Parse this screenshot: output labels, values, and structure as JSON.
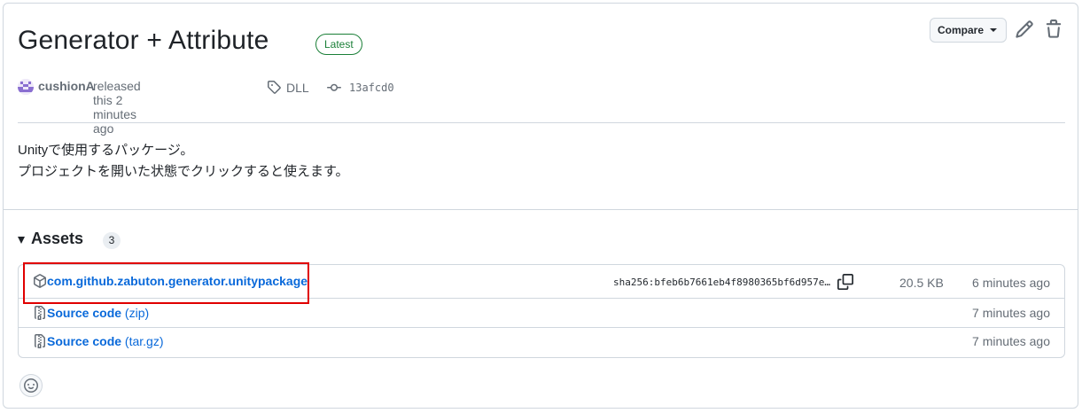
{
  "release": {
    "title": "Generator + Attribute",
    "badge": "Latest",
    "author": "cushionA",
    "released_text": "released this 2 minutes ago",
    "tag": "DLL",
    "commit": "13afcd0"
  },
  "toolbar": {
    "compare_label": "Compare",
    "edit_icon": "pencil-icon",
    "delete_icon": "trash-icon"
  },
  "description": {
    "line1": "Unityで使用するパッケージ。",
    "line2": "プロジェクトを開いた状態でクリックすると使えます。"
  },
  "assets": {
    "title": "Assets",
    "count": "3",
    "items": [
      {
        "name": "com.github.zabuton.generator.unitypackage",
        "sub": "",
        "sha": "sha256:bfeb6b7661eb4f8980365bf6d957e…",
        "size": "20.5 KB",
        "time": "6 minutes ago",
        "icon": "package-icon"
      },
      {
        "name": "Source code",
        "sub": "(zip)",
        "time": "7 minutes ago",
        "icon": "file-zip-icon"
      },
      {
        "name": "Source code",
        "sub": "(tar.gz)",
        "time": "7 minutes ago",
        "icon": "file-zip-icon"
      }
    ]
  },
  "colors": {
    "link": "#0969da",
    "latest": "#1a7f37",
    "highlight": "#e00000"
  }
}
